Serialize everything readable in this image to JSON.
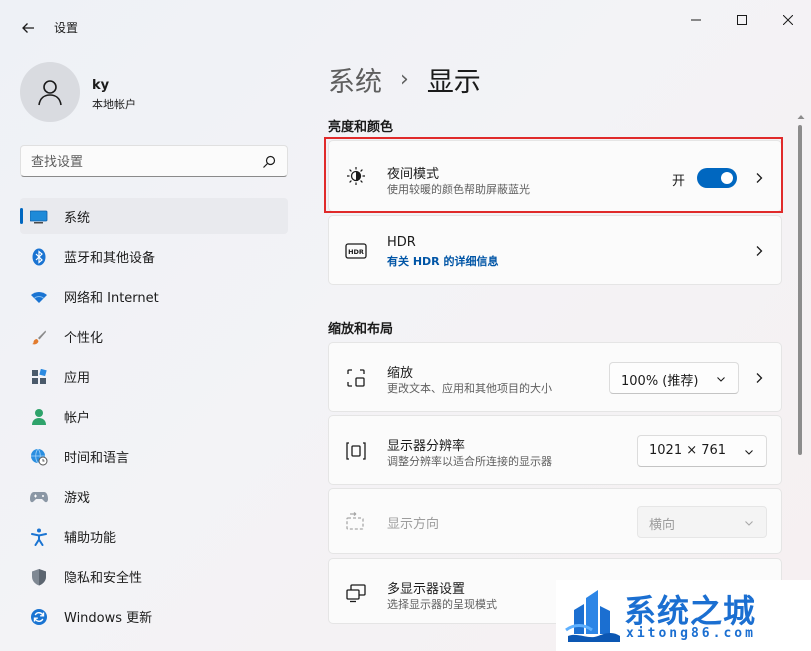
{
  "window": {
    "title": "设置"
  },
  "user": {
    "name": "ky",
    "account_type": "本地帐户"
  },
  "search": {
    "placeholder": "查找设置"
  },
  "sidebar": {
    "items": [
      {
        "label": "系统",
        "icon": "monitor-icon",
        "active": true
      },
      {
        "label": "蓝牙和其他设备",
        "icon": "bluetooth-icon"
      },
      {
        "label": "网络和 Internet",
        "icon": "wifi-icon"
      },
      {
        "label": "个性化",
        "icon": "paintbrush-icon"
      },
      {
        "label": "应用",
        "icon": "apps-icon"
      },
      {
        "label": "帐户",
        "icon": "person-icon"
      },
      {
        "label": "时间和语言",
        "icon": "globe-clock-icon"
      },
      {
        "label": "游戏",
        "icon": "gamepad-icon"
      },
      {
        "label": "辅助功能",
        "icon": "accessibility-icon"
      },
      {
        "label": "隐私和安全性",
        "icon": "shield-icon"
      },
      {
        "label": "Windows 更新",
        "icon": "update-icon"
      }
    ]
  },
  "breadcrumb": {
    "parent": "系统",
    "separator": "›",
    "current": "显示"
  },
  "sections": {
    "brightness_color": "亮度和颜色",
    "scale_layout": "缩放和布局"
  },
  "night_light": {
    "title": "夜间模式",
    "subtitle": "使用较暖的颜色帮助屏蔽蓝光",
    "state_label": "开",
    "on": true
  },
  "hdr": {
    "title": "HDR",
    "link": "有关 HDR 的详细信息"
  },
  "scale": {
    "title": "缩放",
    "subtitle": "更改文本、应用和其他项目的大小",
    "value": "100% (推荐)"
  },
  "resolution": {
    "title": "显示器分辨率",
    "subtitle": "调整分辨率以适合所连接的显示器",
    "value": "1021 × 761"
  },
  "orientation": {
    "title": "显示方向",
    "value": "横向",
    "disabled": true
  },
  "multi_display": {
    "title": "多显示器设置",
    "subtitle": "选择显示器的呈现模式"
  },
  "watermark": {
    "brand": "系统之城",
    "url": "xitong86.com"
  },
  "colors": {
    "accent": "#0067c0",
    "highlight_border": "#e02a2a",
    "watermark_blue": "#1b6fd1"
  }
}
